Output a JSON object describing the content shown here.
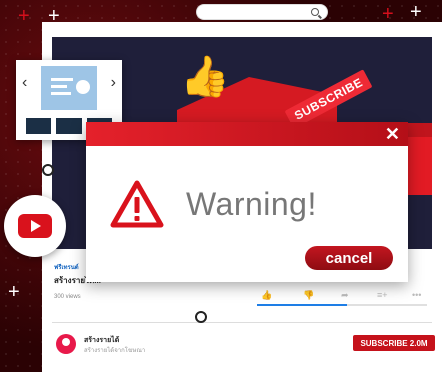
{
  "video": {
    "subscribe_tag": "SUBSCRIBE"
  },
  "info": {
    "channel_small": "ฟรีเทรนด์",
    "title": "สร้างรายได้...",
    "views": "300 views"
  },
  "channel": {
    "name": "สร้างรายได้",
    "sub": "สร้างรายได้จากโฆษณา",
    "subscribe_label": "SUBSCRIBE 2.0M"
  },
  "dialog": {
    "title": "Warning!",
    "close": "✕",
    "cancel": "cancel"
  },
  "colors": {
    "accent": "#d50f1c",
    "dark_bg": "#2b0204",
    "blue": "#1e7ee6"
  }
}
